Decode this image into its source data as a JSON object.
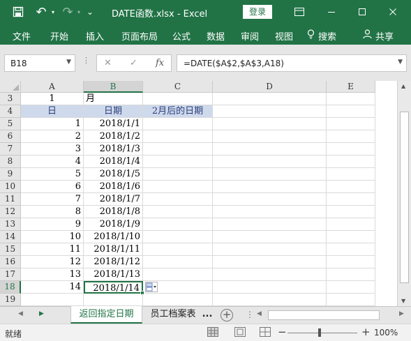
{
  "window": {
    "title": "DATE函数.xlsx  -  Excel",
    "login_label": "登录",
    "qa_undo_glyph": "↶",
    "qa_redo_glyph": "↷",
    "qa_more_glyph": "⌄"
  },
  "ribbon": {
    "tabs": [
      "文件",
      "开始",
      "插入",
      "页面布局",
      "公式",
      "数据",
      "审阅",
      "视图",
      "搜索"
    ],
    "share_label": "共享"
  },
  "formula_bar": {
    "name_box": "B18",
    "formula": "=DATE($A$2,$A$3,A18)",
    "fx_label": "fx"
  },
  "sheet": {
    "columns": [
      {
        "id": "A",
        "label": "A",
        "selected": false
      },
      {
        "id": "B",
        "label": "B",
        "selected": true
      },
      {
        "id": "C",
        "label": "C",
        "selected": false
      },
      {
        "id": "D",
        "label": "D",
        "selected": false
      },
      {
        "id": "E",
        "label": "E",
        "selected": false
      }
    ],
    "rows": [
      {
        "num": "3",
        "a": "1",
        "b": "月",
        "c": ""
      },
      {
        "num": "4",
        "a": "日",
        "b": "日期",
        "c": "2月后的日期",
        "header": true
      },
      {
        "num": "5",
        "a": "1",
        "b": "2018/1/1",
        "c": ""
      },
      {
        "num": "6",
        "a": "2",
        "b": "2018/1/2",
        "c": ""
      },
      {
        "num": "7",
        "a": "3",
        "b": "2018/1/3",
        "c": ""
      },
      {
        "num": "8",
        "a": "4",
        "b": "2018/1/4",
        "c": ""
      },
      {
        "num": "9",
        "a": "5",
        "b": "2018/1/5",
        "c": ""
      },
      {
        "num": "10",
        "a": "6",
        "b": "2018/1/6",
        "c": ""
      },
      {
        "num": "11",
        "a": "7",
        "b": "2018/1/7",
        "c": ""
      },
      {
        "num": "12",
        "a": "8",
        "b": "2018/1/8",
        "c": ""
      },
      {
        "num": "13",
        "a": "9",
        "b": "2018/1/9",
        "c": ""
      },
      {
        "num": "14",
        "a": "10",
        "b": "2018/1/10",
        "c": ""
      },
      {
        "num": "15",
        "a": "11",
        "b": "2018/1/11",
        "c": ""
      },
      {
        "num": "16",
        "a": "12",
        "b": "2018/1/12",
        "c": ""
      },
      {
        "num": "17",
        "a": "13",
        "b": "2018/1/13",
        "c": ""
      },
      {
        "num": "18",
        "a": "14",
        "b": "2018/1/14",
        "c": "",
        "active": true
      },
      {
        "num": "19",
        "a": "",
        "b": "",
        "c": ""
      }
    ]
  },
  "tabs_bar": {
    "sheet_tabs": [
      {
        "label": "返回指定日期",
        "active": true
      },
      {
        "label": "员工档案表",
        "active": false
      }
    ],
    "more_label": "...",
    "add_label": "+"
  },
  "status_bar": {
    "ready_label": "就绪",
    "zoom": "100%",
    "zoom_minus": "−",
    "zoom_plus": "+"
  },
  "colors": {
    "brand_green": "#217346",
    "header_fill": "#cfd9ec",
    "header_text": "#2a3f7a"
  }
}
